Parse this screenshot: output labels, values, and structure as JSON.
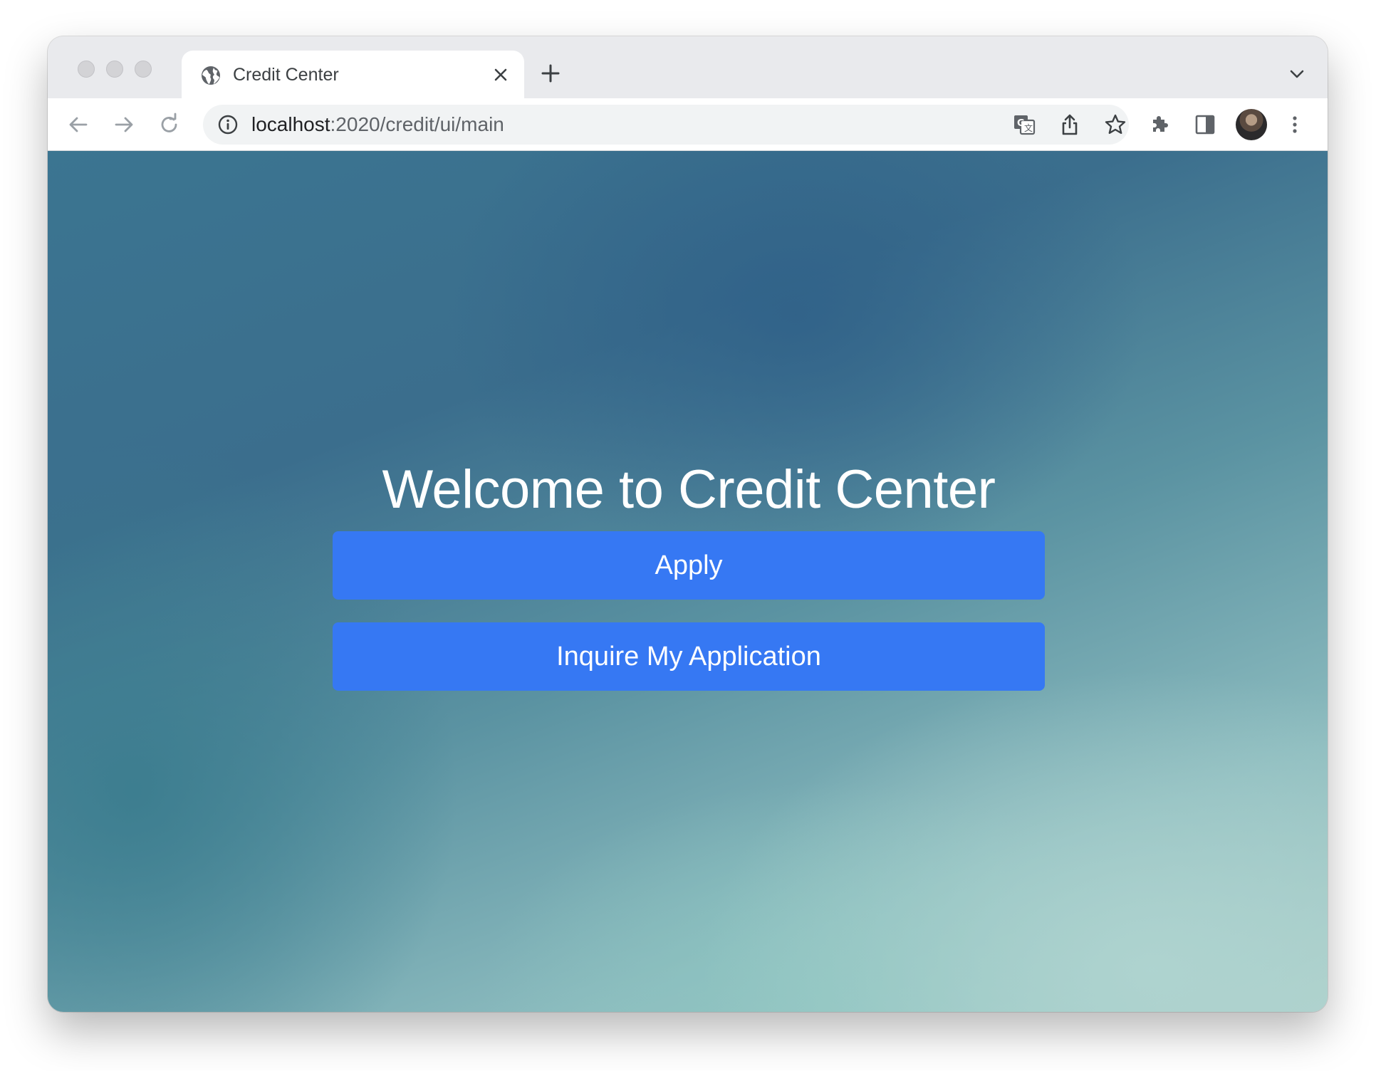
{
  "browser": {
    "tab": {
      "title": "Credit Center",
      "favicon": "globe-icon"
    },
    "address_bar": {
      "host": "localhost",
      "path": ":2020/credit/ui/main"
    },
    "icons": {
      "back": "arrow-left-icon",
      "forward": "arrow-right-icon",
      "reload": "reload-icon",
      "site_info": "info-icon",
      "translate": "translate-icon",
      "share": "share-icon",
      "bookmark": "star-icon",
      "extensions": "puzzle-icon",
      "side_panel": "side-panel-icon",
      "menu": "kebab-menu-icon",
      "new_tab": "plus-icon",
      "tab_search": "chevron-down-icon",
      "close_tab": "close-icon"
    }
  },
  "page": {
    "heading": "Welcome to Credit Center",
    "buttons": {
      "apply": "Apply",
      "inquire": "Inquire My Application"
    }
  },
  "colors": {
    "button_bg": "#3678f3",
    "button_text": "#ffffff",
    "heading_text": "#ffffff",
    "background_top": "#3b6e8d",
    "background_bottom": "#b0d0ca"
  }
}
